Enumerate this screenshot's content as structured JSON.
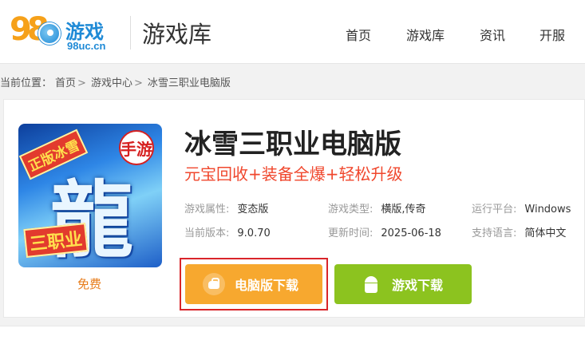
{
  "header": {
    "logo": {
      "digits": "98",
      "brand": "游戏",
      "domain": "98uc.cn"
    },
    "site_title": "游戏库",
    "nav": [
      "首页",
      "游戏库",
      "资讯",
      "开服"
    ]
  },
  "breadcrumb": {
    "prefix": "当前位置：",
    "items": [
      "首页",
      "游戏中心",
      "冰雪三职业电脑版"
    ],
    "separator": ">"
  },
  "game": {
    "title": "冰雪三职业电脑版",
    "slogan": "元宝回收+装备全爆+轻松升级",
    "price": "免费",
    "cover_texts": {
      "tag1": "正版冰雪",
      "tag2": "三职业",
      "big": "龍",
      "seal": "手游"
    },
    "info": [
      {
        "key": "游戏属性:",
        "value": "变态版"
      },
      {
        "key": "游戏类型:",
        "value": "横版,传奇"
      },
      {
        "key": "运行平台:",
        "value": "Windows"
      },
      {
        "key": "当前版本:",
        "value": "9.0.70"
      },
      {
        "key": "更新时间:",
        "value": "2025-06-18"
      },
      {
        "key": "支持语言:",
        "value": "简体中文"
      }
    ],
    "buttons": {
      "pc_download": "电脑版下载",
      "game_download": "游戏下载"
    }
  },
  "colors": {
    "accent_orange": "#f7a82f",
    "accent_green": "#8cc31f",
    "slogan_red": "#f0472d",
    "highlight_red": "#d9252a",
    "brand_blue": "#1f8ad6"
  }
}
